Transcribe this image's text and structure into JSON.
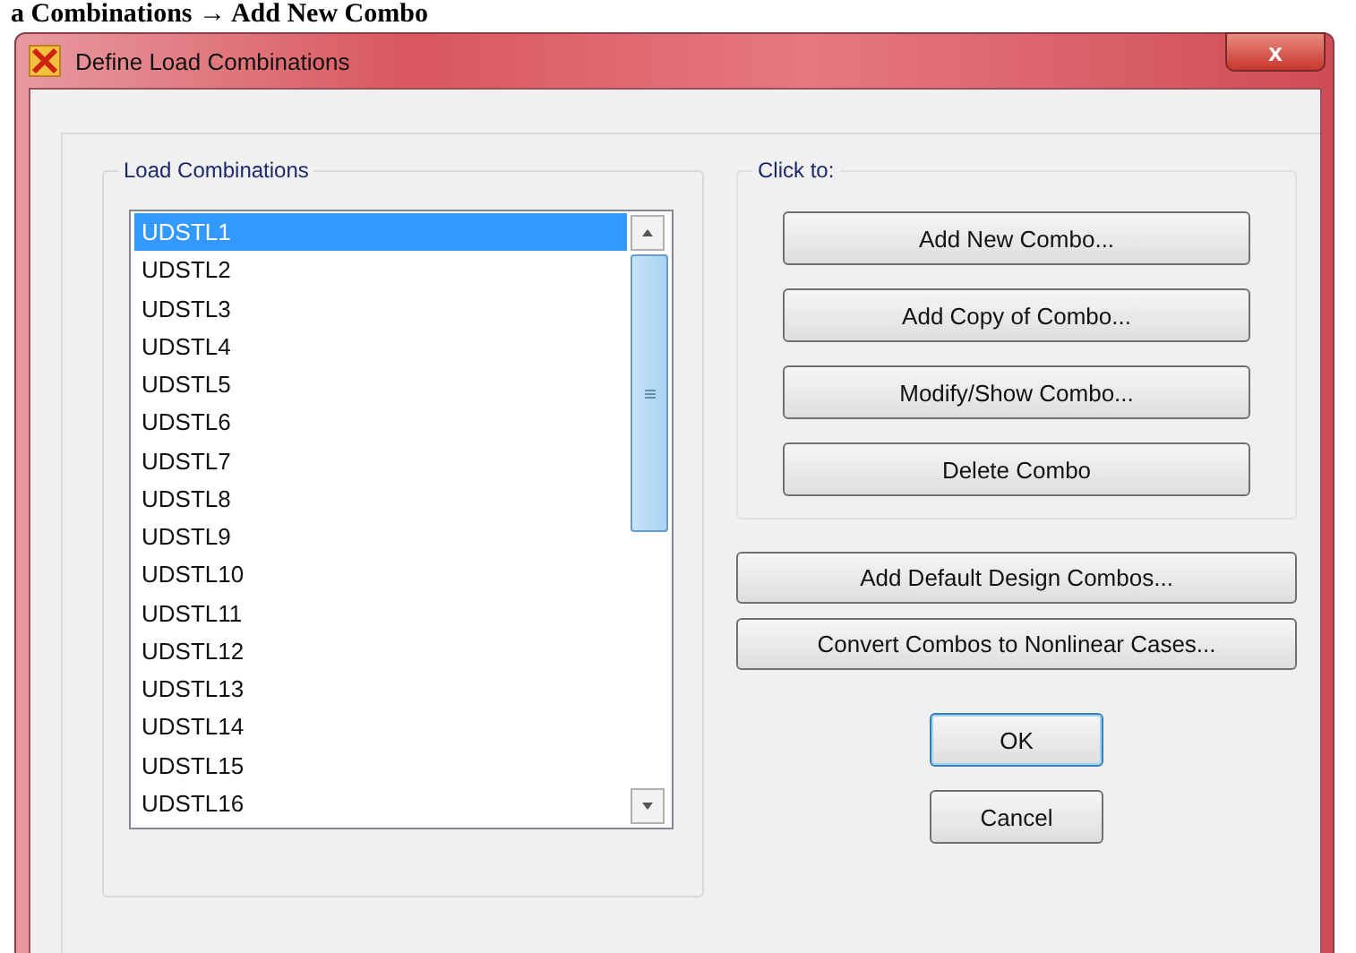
{
  "heading": "a Combinations → Add New Combo",
  "window": {
    "title": "Define Load Combinations",
    "close": "x"
  },
  "load_combinations": {
    "title": "Load Combinations",
    "items": [
      {
        "label": "UDSTL1",
        "selected": true
      },
      {
        "label": "UDSTL2",
        "selected": false
      },
      {
        "label": "UDSTL3",
        "selected": false
      },
      {
        "label": "UDSTL4",
        "selected": false
      },
      {
        "label": "UDSTL5",
        "selected": false
      },
      {
        "label": "UDSTL6",
        "selected": false
      },
      {
        "label": "UDSTL7",
        "selected": false
      },
      {
        "label": "UDSTL8",
        "selected": false
      },
      {
        "label": "UDSTL9",
        "selected": false
      },
      {
        "label": "UDSTL10",
        "selected": false
      },
      {
        "label": "UDSTL11",
        "selected": false
      },
      {
        "label": "UDSTL12",
        "selected": false
      },
      {
        "label": "UDSTL13",
        "selected": false
      },
      {
        "label": "UDSTL14",
        "selected": false
      },
      {
        "label": "UDSTL15",
        "selected": false
      },
      {
        "label": "UDSTL16",
        "selected": false
      }
    ]
  },
  "click_to": {
    "title": "Click to:",
    "buttons": [
      "Add New Combo...",
      "Add Copy of Combo...",
      "Modify/Show Combo...",
      "Delete Combo"
    ]
  },
  "extra_buttons": [
    "Add Default Design Combos...",
    "Convert Combos to Nonlinear Cases..."
  ],
  "ok_button": {
    "label": "OK",
    "focused": true
  },
  "cancel_button": "Cancel"
}
